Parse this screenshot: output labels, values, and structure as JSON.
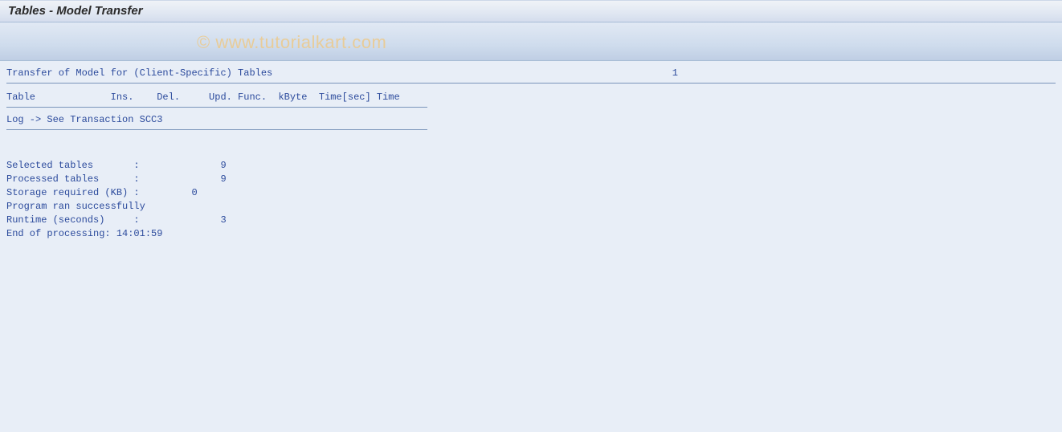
{
  "title_bar": {
    "title": "Tables - Model Transfer"
  },
  "watermark": "© www.tutorialkart.com",
  "report": {
    "header": {
      "text": "Transfer of Model for (Client-Specific) Tables",
      "page_number": "1"
    },
    "columns_line": "Table             Ins.    Del.     Upd. Func.  kByte  Time[sec] Time",
    "log_line": "Log -> See Transaction SCC3",
    "stats": {
      "selected_tables": "Selected tables       :              9",
      "processed_tables": "Processed tables      :              9",
      "storage_required": "Storage required (KB) :         0",
      "program_ran": "Program ran successfully",
      "runtime": "Runtime (seconds)     :              3",
      "end_processing": "End of processing: 14:01:59"
    }
  }
}
